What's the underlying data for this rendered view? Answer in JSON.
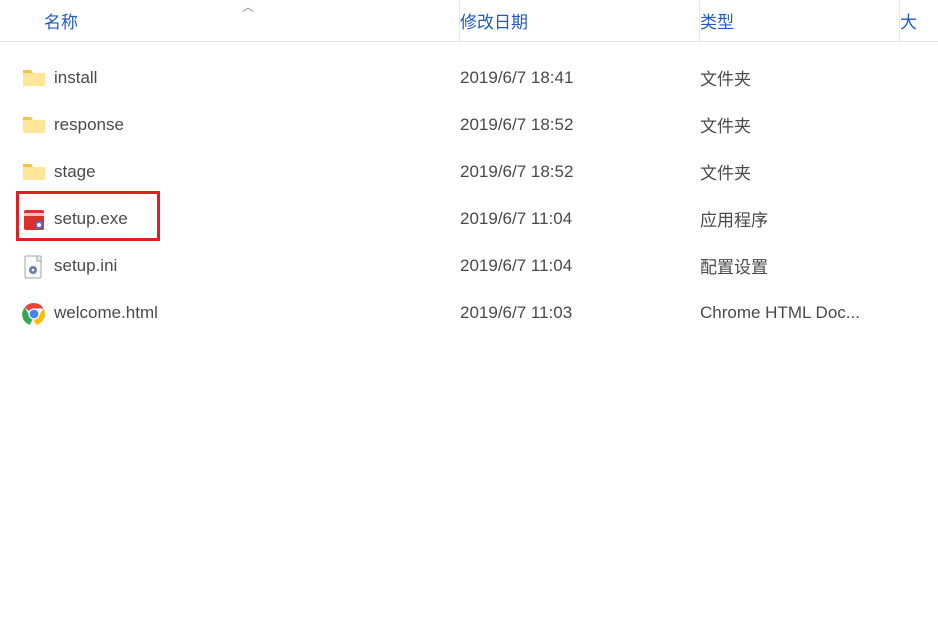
{
  "headers": {
    "name": "名称",
    "date": "修改日期",
    "type": "类型",
    "size": "大"
  },
  "rows": [
    {
      "icon": "folder",
      "name": "install",
      "date": "2019/6/7 18:41",
      "type": "文件夹"
    },
    {
      "icon": "folder",
      "name": "response",
      "date": "2019/6/7 18:52",
      "type": "文件夹"
    },
    {
      "icon": "folder",
      "name": "stage",
      "date": "2019/6/7 18:52",
      "type": "文件夹"
    },
    {
      "icon": "exe",
      "name": "setup.exe",
      "date": "2019/6/7 11:04",
      "type": "应用程序",
      "highlighted": true
    },
    {
      "icon": "ini",
      "name": "setup.ini",
      "date": "2019/6/7 11:04",
      "type": "配置设置"
    },
    {
      "icon": "chrome",
      "name": "welcome.html",
      "date": "2019/6/7 11:03",
      "type": "Chrome HTML Doc..."
    }
  ]
}
